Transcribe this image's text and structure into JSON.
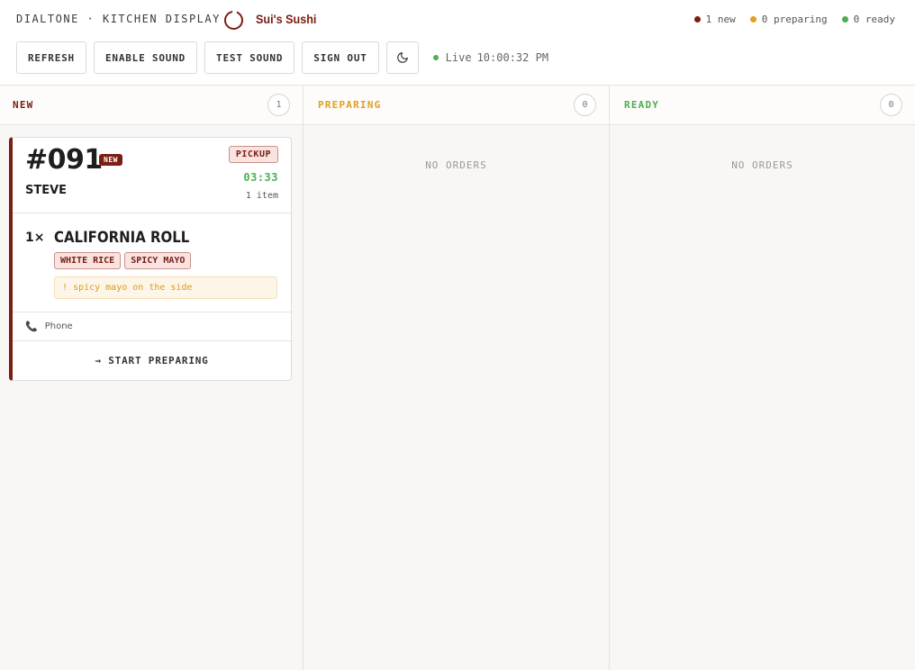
{
  "header": {
    "brand": "DIALTONE · KITCHEN DISPLAY",
    "restaurant": "Sui's Sushi",
    "counts": [
      {
        "label": "1 new",
        "color": "#7a1d12"
      },
      {
        "label": "0 preparing",
        "color": "#e0a020"
      },
      {
        "label": "0 ready",
        "color": "#4caf50"
      }
    ]
  },
  "toolbar": {
    "refresh": "REFRESH",
    "enable_sound": "ENABLE SOUND",
    "test_sound": "TEST SOUND",
    "sign_out": "SIGN OUT",
    "theme_icon": "moon-icon",
    "live_label": "Live",
    "live_time": "10:00:32 PM",
    "live_color": "#4caf50"
  },
  "columns": [
    {
      "title": "NEW",
      "count": "1",
      "color": "#7a1d12"
    },
    {
      "title": "PREPARING",
      "count": "0",
      "color": "#e0a020",
      "empty": "NO ORDERS"
    },
    {
      "title": "READY",
      "count": "0",
      "color": "#4caf50",
      "empty": "NO ORDERS"
    }
  ],
  "order": {
    "number": "#091",
    "badge": "NEW",
    "customer": "STEVE",
    "type": "PICKUP",
    "timer": "03:33",
    "items_count": "1 item",
    "items": [
      {
        "qty": "1×",
        "name": "CALIFORNIA ROLL",
        "modifiers": [
          "WHITE RICE",
          "SPICY MAYO"
        ],
        "note": "! spicy mayo on the side"
      }
    ],
    "source_icon": "phone-icon",
    "source": "Phone",
    "action": "→ START PREPARING"
  }
}
